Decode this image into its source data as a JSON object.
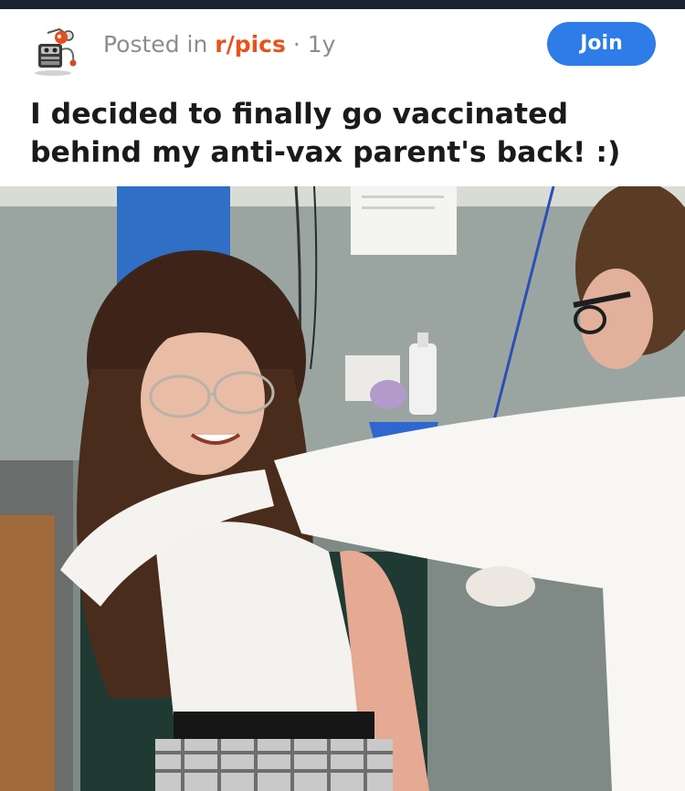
{
  "post": {
    "posted_in_prefix": "Posted in ",
    "subreddit": "r/pics",
    "separator": " · ",
    "age": "1y",
    "join_label": "Join",
    "title": "I decided to finally go vaccinated behind my anti-vax parent's back! :)"
  },
  "icons": {
    "avatar": "reddit-snoo-avatar-icon"
  },
  "colors": {
    "top_bar": "#1b2330",
    "subreddit_accent": "#e8521b",
    "join_button": "#2e7ce8",
    "meta_text": "#8a8d91",
    "title_text": "#1a1a1b"
  }
}
